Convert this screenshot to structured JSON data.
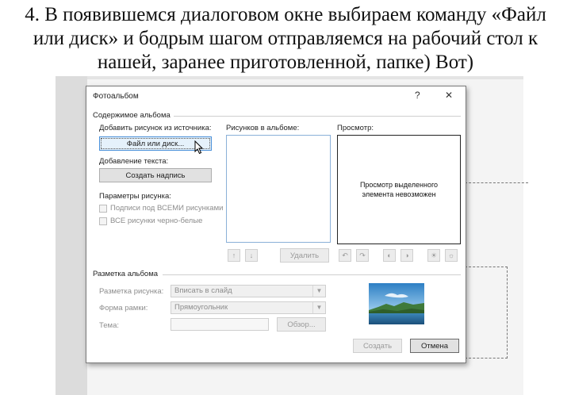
{
  "caption": {
    "line1": "4. В появившемся диалоговом окне выбираем команду «Файл",
    "line2": "или диск» и бодрым шагом отправляемся на рабочий стол к",
    "line3": "нашей, заранее приготовленной, папке) Вот)"
  },
  "dialog": {
    "title": "Фотоальбом",
    "help_glyph": "?",
    "close_glyph": "✕",
    "album_content": {
      "group_label": "Содержимое альбома",
      "insert_from_label": "Добавить рисунок из источника:",
      "file_or_disk_button": "Файл или диск...",
      "insert_text_label": "Добавление текста:",
      "new_text_box_button": "Создать надпись",
      "picture_options_label": "Параметры рисунка:",
      "captions_checkbox": "Подписи под ВСЕМИ рисунками",
      "bw_checkbox": "ВСЕ рисунки черно-белые",
      "pictures_in_album_label": "Рисунков в альбоме:",
      "preview_label": "Просмотр:",
      "preview_text": "Просмотр выделенного элемента невозможен",
      "remove_button": "Удалить"
    },
    "album_layout": {
      "group_label": "Разметка альбома",
      "picture_layout_label": "Разметка рисунка:",
      "picture_layout_value": "Вписать в слайд",
      "frame_shape_label": "Форма рамки:",
      "frame_shape_value": "Прямоугольник",
      "theme_label": "Тема:",
      "browse_button": "Обзор..."
    },
    "create_button": "Создать",
    "cancel_button": "Отмена",
    "icons": {
      "up": "arrow-up-icon",
      "down": "arrow-down-icon",
      "rotate_left": "rotate-left-icon",
      "rotate_right": "rotate-right-icon",
      "contrast_up": "contrast-up-icon",
      "contrast_down": "contrast-down-icon",
      "brightness_up": "brightness-up-icon",
      "brightness_down": "brightness-down-icon"
    }
  }
}
